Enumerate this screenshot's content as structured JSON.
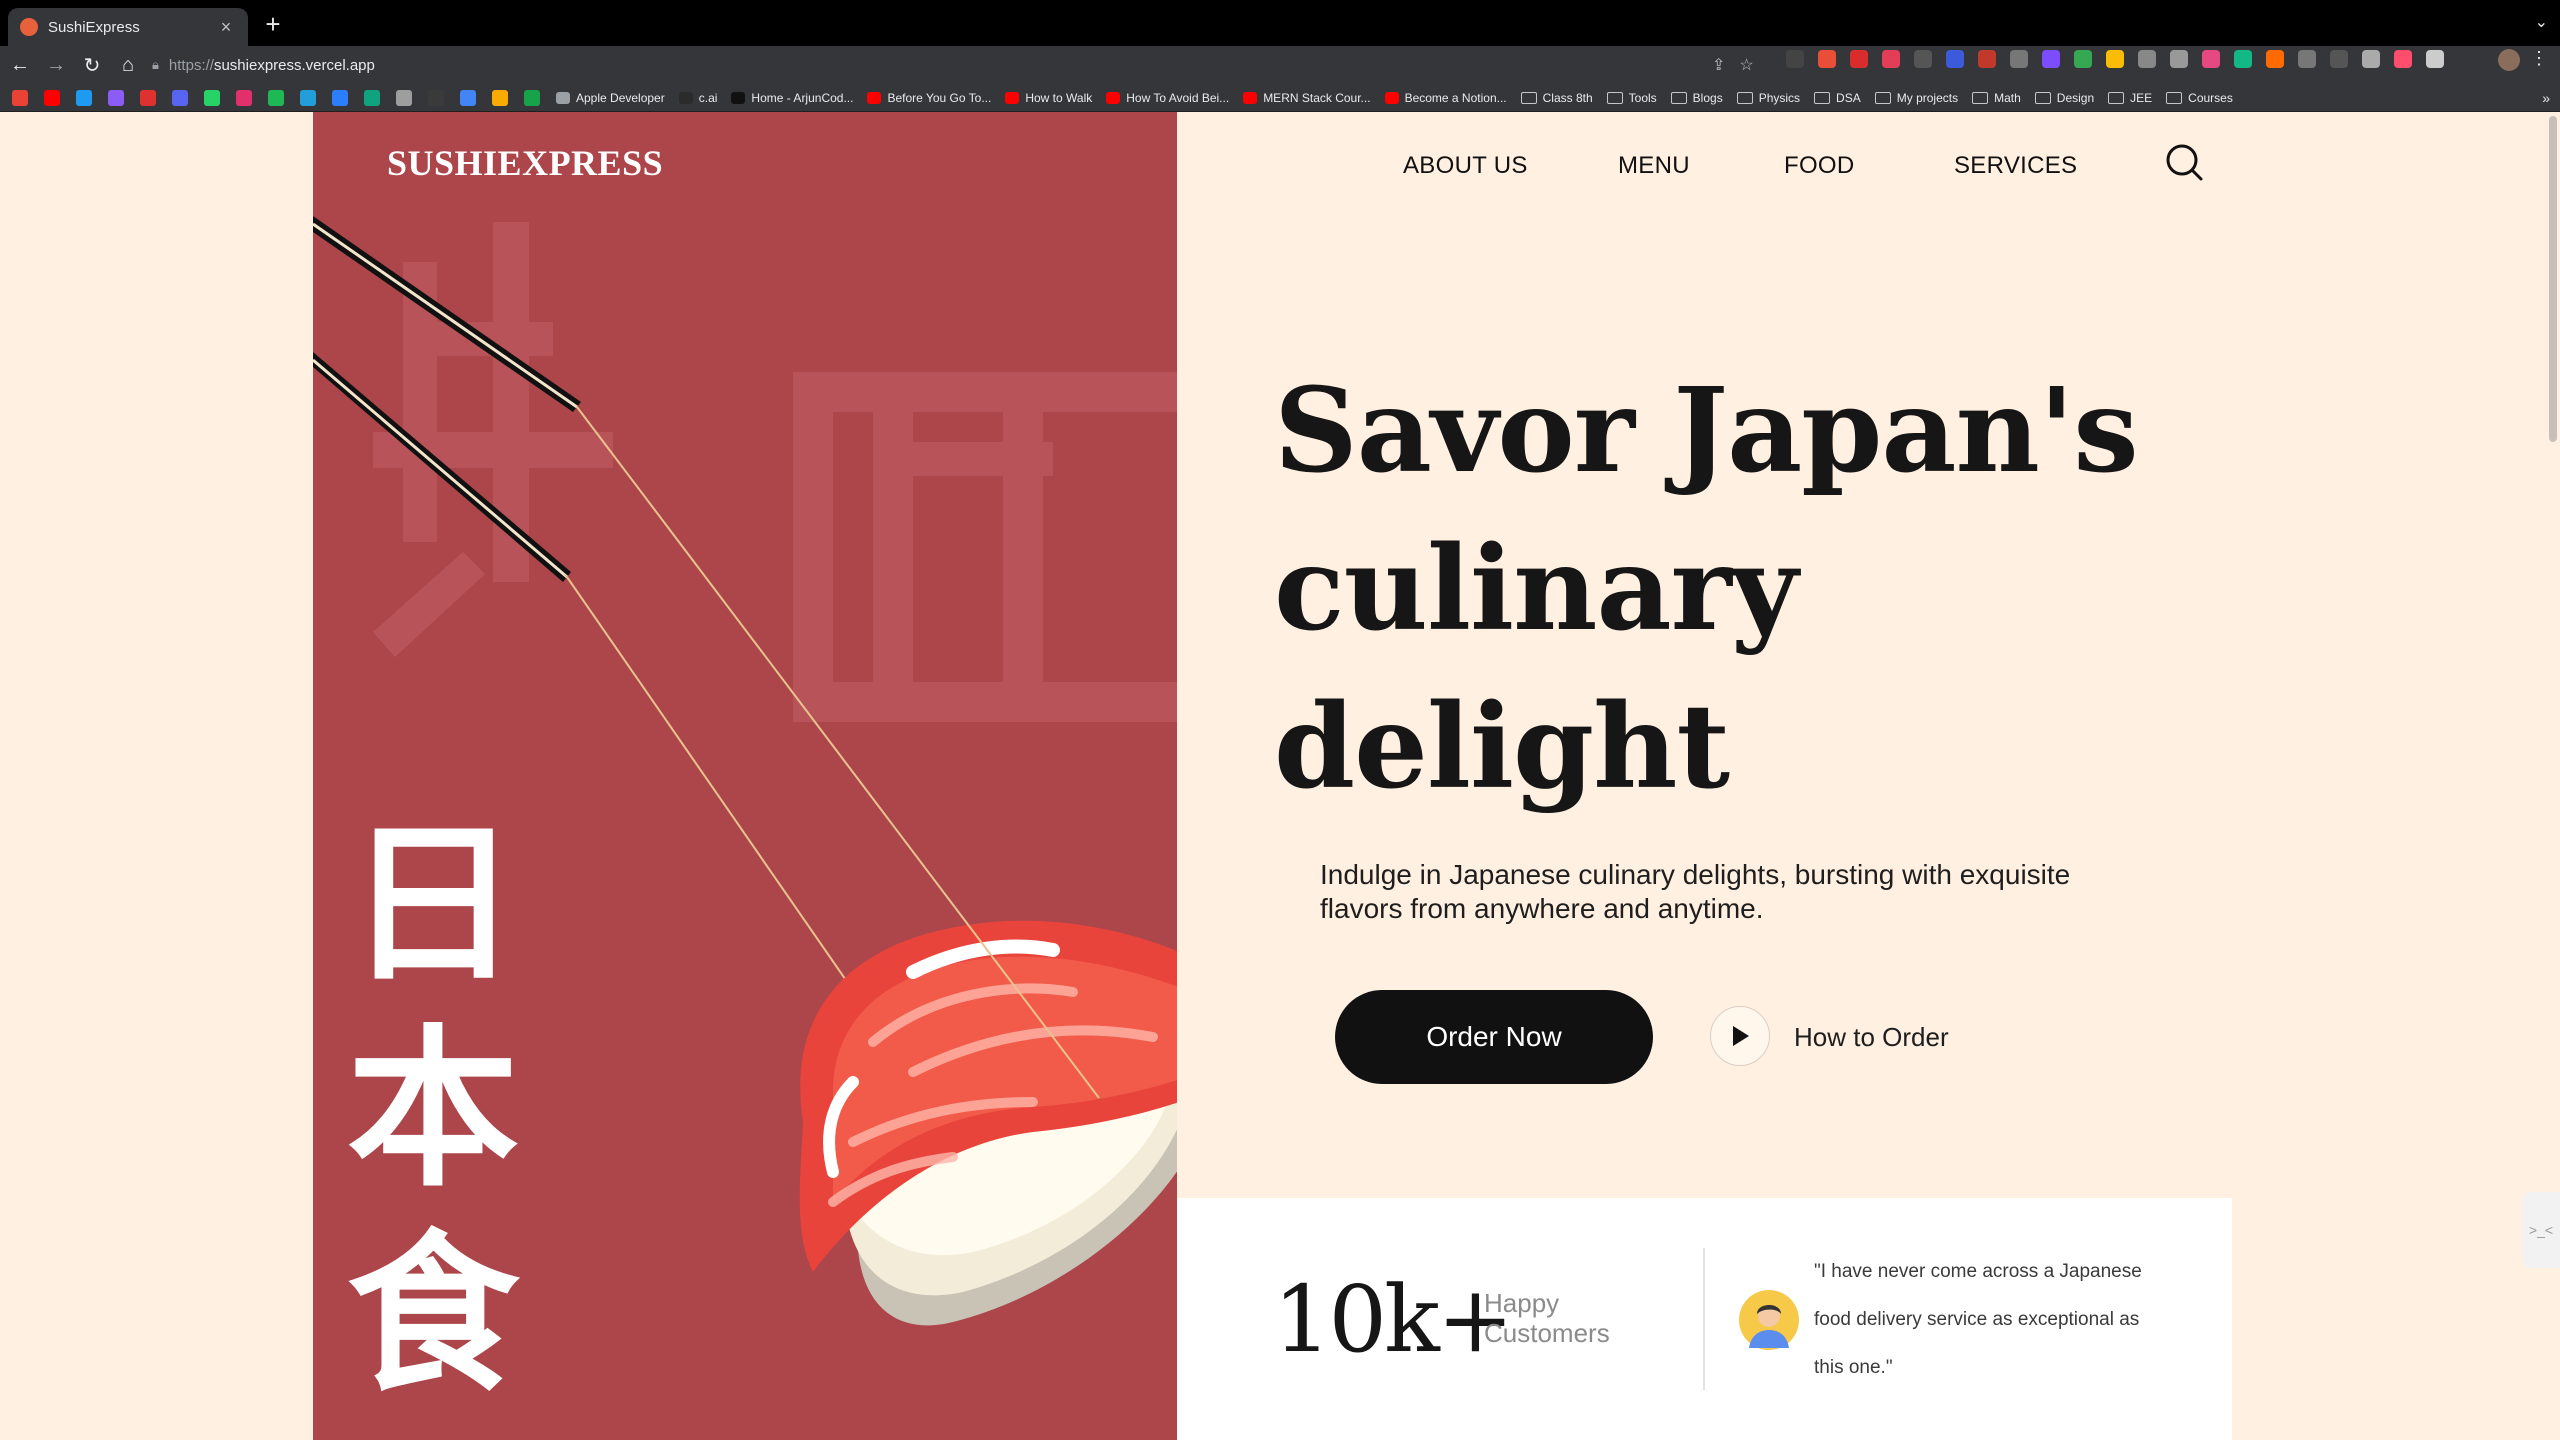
{
  "browser": {
    "tab_title": "SushiExpress",
    "new_tab_label": "+",
    "url_scheme": "https://",
    "url_host": "sushiexpress.vercel.app",
    "bookmarks": [
      {
        "label": "Apple Developer",
        "kind": "site",
        "color": "#9aa0a6"
      },
      {
        "label": "c.ai",
        "kind": "site",
        "color": "#2b2b2b"
      },
      {
        "label": "Home - ArjunCod...",
        "kind": "site",
        "color": "#111111"
      },
      {
        "label": "Before You Go To...",
        "kind": "site",
        "color": "#ff0000"
      },
      {
        "label": "How to Walk",
        "kind": "site",
        "color": "#ff0000"
      },
      {
        "label": "How To Avoid Bei...",
        "kind": "site",
        "color": "#ff0000"
      },
      {
        "label": "MERN Stack Cour...",
        "kind": "site",
        "color": "#ff0000"
      },
      {
        "label": "Become a Notion...",
        "kind": "site",
        "color": "#ff0000"
      },
      {
        "label": "Class 8th",
        "kind": "folder"
      },
      {
        "label": "Tools",
        "kind": "folder"
      },
      {
        "label": "Blogs",
        "kind": "folder"
      },
      {
        "label": "Physics",
        "kind": "folder"
      },
      {
        "label": "DSA",
        "kind": "folder"
      },
      {
        "label": "My projects",
        "kind": "folder"
      },
      {
        "label": "Math",
        "kind": "folder"
      },
      {
        "label": "Design",
        "kind": "folder"
      },
      {
        "label": "JEE",
        "kind": "folder"
      },
      {
        "label": "Courses",
        "kind": "folder"
      }
    ],
    "bookmark_icon_colors": [
      "#ea4335",
      "#ff0000",
      "#1d9bf0",
      "#8b5cf6",
      "#e03131",
      "#5865f2",
      "#25d366",
      "#e1306c",
      "#1db954",
      "#229ed9",
      "#2b7fff",
      "#10a37f",
      "#9e9e9e",
      "#3a3a3a",
      "#4285f4",
      "#f9ab00",
      "#16a34a"
    ],
    "extension_colors": [
      "#444",
      "#e94f37",
      "#d92d2d",
      "#e23e57",
      "#555",
      "#3b5bdb",
      "#c0392b",
      "#777",
      "#7c4dff",
      "#34a853",
      "#fbbc05",
      "#888",
      "#999",
      "#e64980",
      "#12b886",
      "#ff6b00",
      "#777",
      "#555",
      "#aaa",
      "#ff4d6d",
      "#ccc"
    ]
  },
  "site": {
    "logo": "SUSHIEXPRESS",
    "nav": [
      "ABOUT US",
      "MENU",
      "FOOD",
      "SERVICES"
    ],
    "kanji": [
      "日",
      "本",
      "食"
    ],
    "headline": [
      "Savor Japan's",
      "culinary",
      "delight"
    ],
    "subtext": "Indulge in Japanese culinary delights, bursting with exquisite flavors from anywhere and anytime.",
    "order_button": "Order Now",
    "how_to_order": "How to Order",
    "stat_number": "10k+",
    "stat_label": [
      "Happy",
      "Customers"
    ],
    "testimonial": "\"I have never come across a Japanese food delivery service as exceptional as this one.\"",
    "side_widget_label": ">_<",
    "colors": {
      "hero_red": "#ad464b",
      "page_background": "#fff0e1",
      "button_dark": "#111111"
    }
  }
}
